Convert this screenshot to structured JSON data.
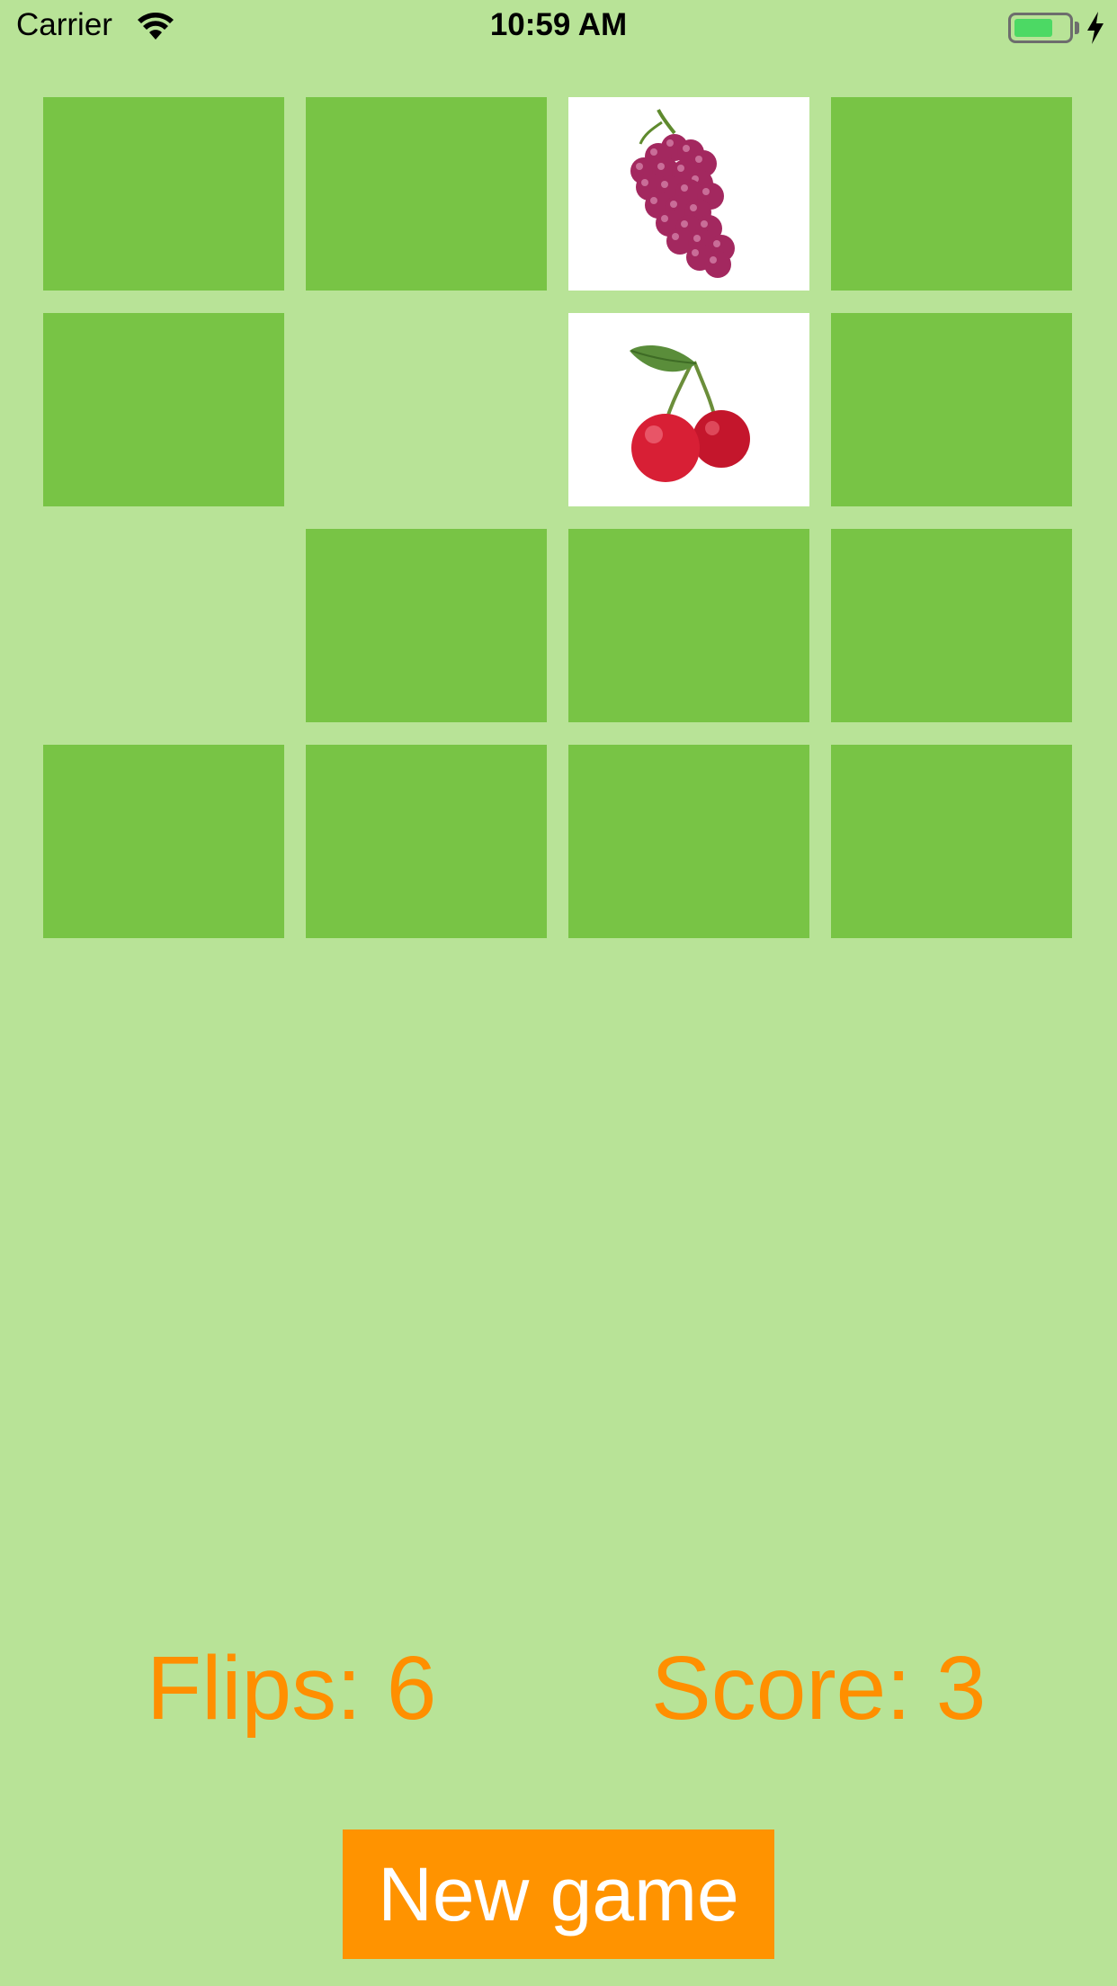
{
  "status_bar": {
    "carrier": "Carrier",
    "time": "10:59 AM",
    "battery_level": 0.72,
    "charging": true,
    "icons": [
      "wifi-icon",
      "battery-icon",
      "charging-bolt-icon"
    ]
  },
  "board": {
    "rows": 4,
    "columns": 4,
    "cards": [
      {
        "state": "face-down"
      },
      {
        "state": "face-down"
      },
      {
        "state": "face-up",
        "fruit": "grapes-icon"
      },
      {
        "state": "face-down"
      },
      {
        "state": "face-down"
      },
      {
        "state": "matched"
      },
      {
        "state": "face-up",
        "fruit": "cherries-icon"
      },
      {
        "state": "face-down"
      },
      {
        "state": "matched"
      },
      {
        "state": "face-down"
      },
      {
        "state": "face-down"
      },
      {
        "state": "face-down"
      },
      {
        "state": "face-down"
      },
      {
        "state": "face-down"
      },
      {
        "state": "face-down"
      },
      {
        "state": "face-down"
      }
    ]
  },
  "stats": {
    "flips_label": "Flips: 6",
    "score_label": "Score: 3"
  },
  "actions": {
    "new_game_label": "New game"
  },
  "colors": {
    "background": "#b8e397",
    "card_back": "#78c445",
    "card_face": "#ffffff",
    "accent": "#ff9300",
    "stat_text": "#ff8f00"
  }
}
